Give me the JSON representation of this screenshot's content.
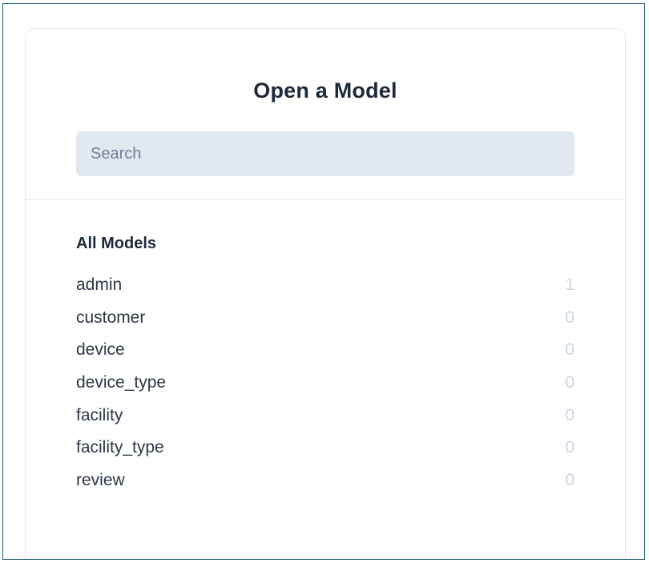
{
  "dialog": {
    "title": "Open a Model",
    "search_placeholder": "Search",
    "search_value": ""
  },
  "models": {
    "section_title": "All Models",
    "items": [
      {
        "name": "admin",
        "count": "1"
      },
      {
        "name": "customer",
        "count": "0"
      },
      {
        "name": "device",
        "count": "0"
      },
      {
        "name": "device_type",
        "count": "0"
      },
      {
        "name": "facility",
        "count": "0"
      },
      {
        "name": "facility_type",
        "count": "0"
      },
      {
        "name": "review",
        "count": "0"
      }
    ]
  },
  "colors": {
    "frame_border": "#1f5f6b",
    "card_border": "#e2e8f0",
    "search_bg": "#e2e8f0",
    "title_text": "#1e293b",
    "count_text": "#cbd5e1"
  }
}
